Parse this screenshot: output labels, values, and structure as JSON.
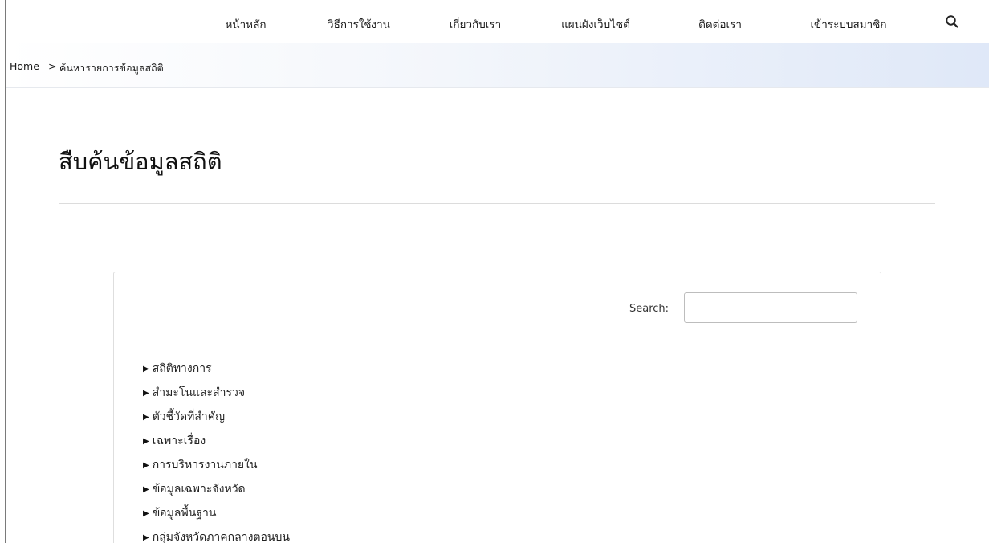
{
  "nav": {
    "items": [
      {
        "id": "home",
        "label": "หน้าหลัก"
      },
      {
        "id": "howto",
        "label": "วิธีการใช้งาน"
      },
      {
        "id": "about",
        "label": "เกี่ยวกับเรา"
      },
      {
        "id": "sitemap",
        "label": "แผนผังเว็บไซต์"
      },
      {
        "id": "contact",
        "label": "ติดต่อเรา"
      },
      {
        "id": "login",
        "label": "เข้าระบบสมาชิก"
      }
    ],
    "search_icon": "search-icon"
  },
  "breadcrumb": {
    "home": "Home",
    "separator": ">",
    "current": "ค้นหารายการข้อมูลสถิติ"
  },
  "page": {
    "title": "สืบค้นข้อมูลสถิติ"
  },
  "search": {
    "label": "Search:",
    "value": ""
  },
  "tree": {
    "caret_icon": "caret-right-icon",
    "items": [
      {
        "label": "สถิติทางการ"
      },
      {
        "label": "สำมะโนและสำรวจ"
      },
      {
        "label": "ตัวชี้วัดที่สำคัญ"
      },
      {
        "label": "เฉพาะเรื่อง"
      },
      {
        "label": "การบริหารงานภายใน"
      },
      {
        "label": "ข้อมูลเฉพาะจังหวัด"
      },
      {
        "label": "ข้อมูลพื้นฐาน"
      },
      {
        "label": "กลุ่มจังหวัดภาคกลางตอนบน"
      }
    ]
  }
}
